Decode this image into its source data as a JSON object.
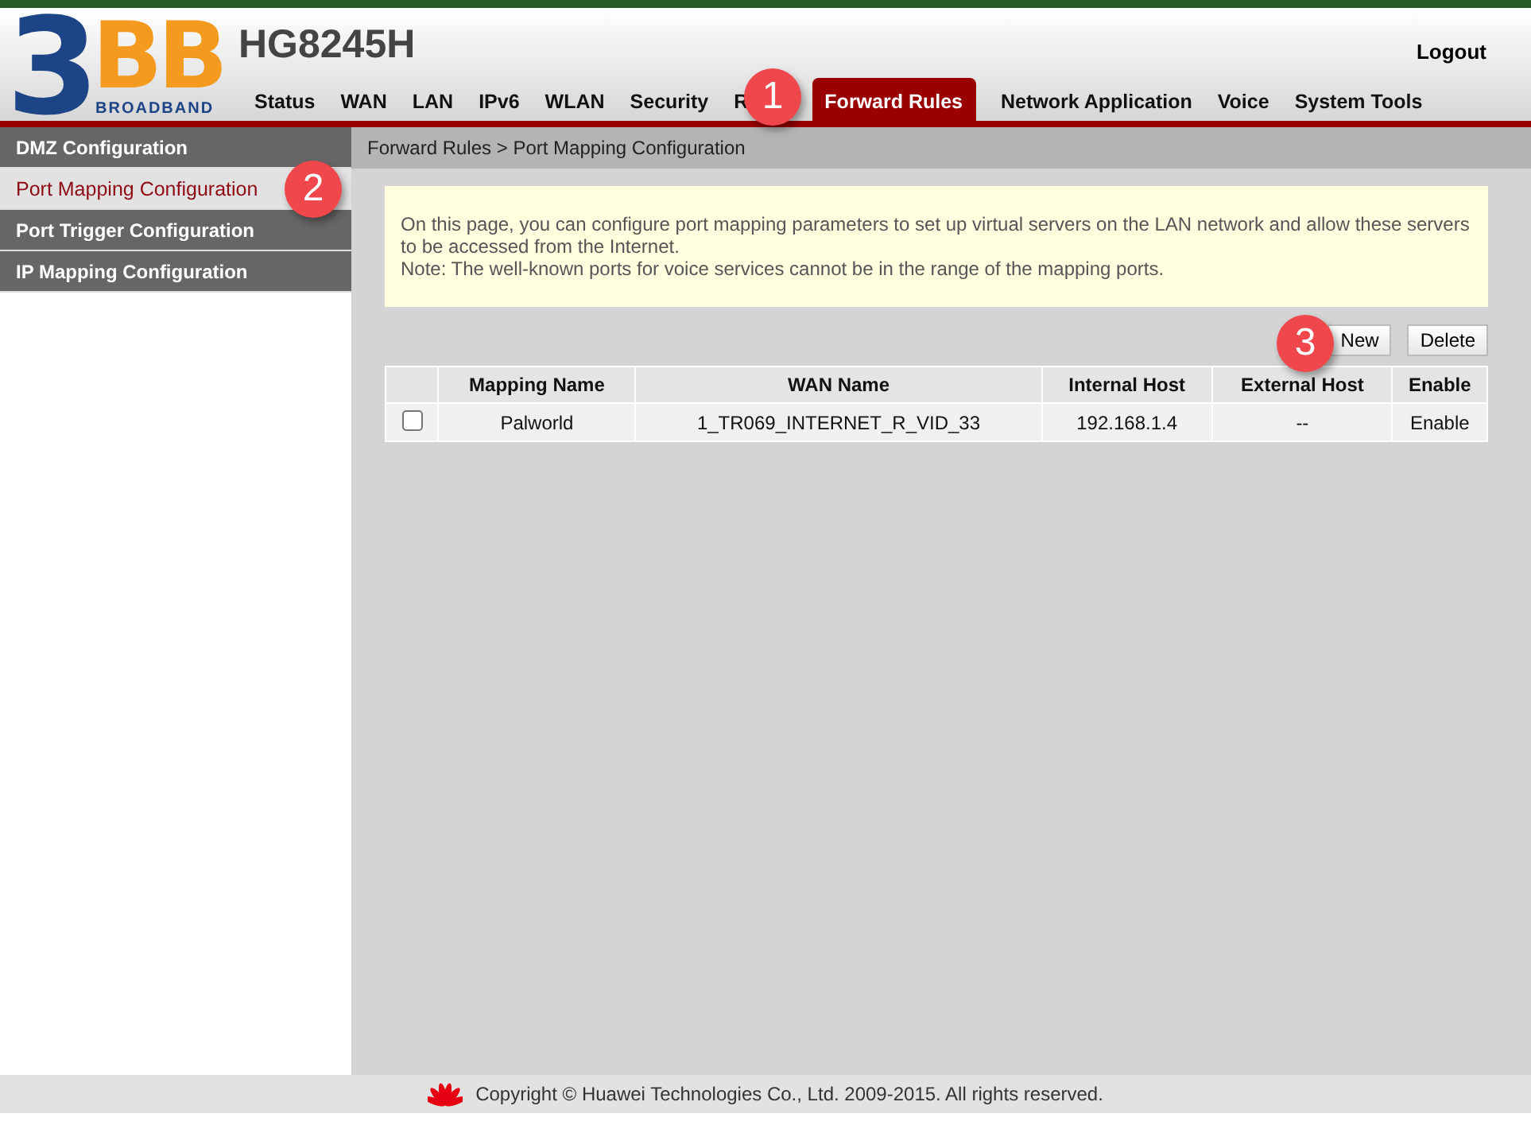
{
  "logo": {
    "mark": "3",
    "letters": "BB",
    "tagline": "BROADBAND"
  },
  "device": "HG8245H",
  "logout": "Logout",
  "nav": [
    {
      "label": "Status",
      "selected": false
    },
    {
      "label": "WAN",
      "selected": false
    },
    {
      "label": "LAN",
      "selected": false
    },
    {
      "label": "IPv6",
      "selected": false
    },
    {
      "label": "WLAN",
      "selected": false
    },
    {
      "label": "Security",
      "selected": false
    },
    {
      "label": "R",
      "selected": false
    },
    {
      "label": "Forward Rules",
      "selected": true
    },
    {
      "label": "Network Application",
      "selected": false
    },
    {
      "label": "Voice",
      "selected": false
    },
    {
      "label": "System Tools",
      "selected": false
    }
  ],
  "sidebar": [
    {
      "label": "DMZ Configuration",
      "selected": false
    },
    {
      "label": "Port Mapping Configuration",
      "selected": true
    },
    {
      "label": "Port Trigger Configuration",
      "selected": false
    },
    {
      "label": "IP Mapping Configuration",
      "selected": false
    }
  ],
  "breadcrumb": "Forward Rules > Port Mapping Configuration",
  "notice": [
    "On this page, you can configure port mapping parameters to set up virtual servers on the LAN network and allow these servers to be accessed from the Internet.",
    "Note: The well-known ports for voice services cannot be in the range of the mapping ports."
  ],
  "buttons": [
    "New",
    "Delete"
  ],
  "table": {
    "columns": [
      "Mapping Name",
      "WAN Name",
      "Internal Host",
      "External Host",
      "Enable"
    ],
    "rows": [
      {
        "checked": false,
        "cells": [
          "Palworld",
          "1_TR069_INTERNET_R_VID_33",
          "192.168.1.4",
          "--",
          "Enable"
        ]
      }
    ]
  },
  "callouts": [
    "1",
    "2",
    "3"
  ],
  "footer": "Copyright © Huawei Technologies Co., Ltd. 2009-2015. All rights reserved."
}
